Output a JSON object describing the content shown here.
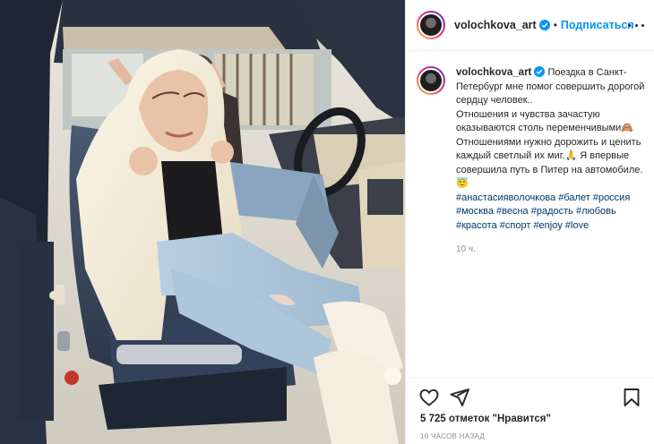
{
  "post": {
    "username": "volochkova_art",
    "follow_label": "Подписаться",
    "separator": "•",
    "caption_text": "Поездка в Санкт-Петербург мне помог совершить дорогой сердцу человек..\nОтношения и чувства зачастую оказываются столь переменчивыми🙈\nОтношениями нужно дорожить и ценить каждый светлый их миг.🙏 Я впервые совершила путь в Питер на автомобиле.😇",
    "hashtags": [
      "#анастасияволочкова",
      "#балет",
      "#россия",
      "#москва",
      "#весна",
      "#радость",
      "#любовь",
      "#красота",
      "#спорт",
      "#enjoy",
      "#love"
    ],
    "caption_time": "10 ч.",
    "likes": "5 725 отметок \"Нравится\"",
    "time_ago": "10 ЧАСОВ НАЗАД"
  },
  "icons": {
    "verified": "verified-badge-icon",
    "more": "more-options-icon",
    "like": "heart-icon",
    "share": "paper-plane-icon",
    "save": "bookmark-icon"
  },
  "colors": {
    "accent": "#0095f6",
    "hashtag": "#00376b",
    "text": "#262626",
    "muted": "#8e8e8e"
  }
}
